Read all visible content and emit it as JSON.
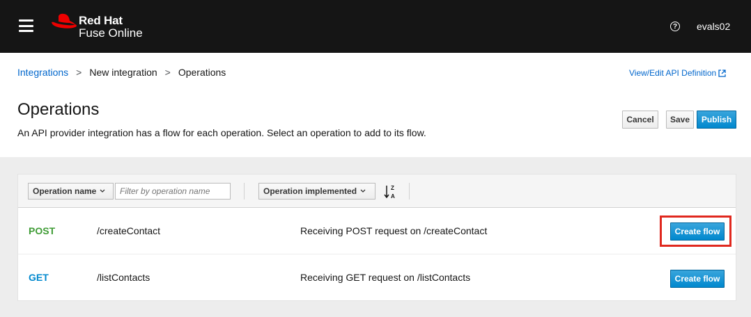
{
  "masthead": {
    "brand_line1": "Red Hat",
    "brand_line2": "Fuse Online",
    "help_glyph": "?",
    "username": "evals02",
    "background": "#151515",
    "logo_color": "#ee0000"
  },
  "breadcrumb": {
    "items": [
      "Integrations",
      "New integration",
      "Operations"
    ],
    "separator": ">"
  },
  "api_link": "View/Edit API Definition",
  "page": {
    "title": "Operations",
    "description": "An API provider integration has a flow for each operation. Select an operation to add to its flow."
  },
  "actions": {
    "cancel": "Cancel",
    "save": "Save",
    "publish": "Publish"
  },
  "toolbar": {
    "filter_type": "Operation name",
    "filter_placeholder": "Filter by operation name",
    "sort_field": "Operation implemented"
  },
  "operations": [
    {
      "method": "POST",
      "method_color": "#3f9c35",
      "path": "/createContact",
      "description": "Receiving POST request on /createContact",
      "action": "Create flow"
    },
    {
      "method": "GET",
      "method_color": "#0088ce",
      "path": "/listContacts",
      "description": "Receiving GET request on /listContacts",
      "action": "Create flow"
    }
  ],
  "colors": {
    "link": "#0066cc",
    "primary": "#0088ce",
    "highlight": "#e0281e"
  }
}
